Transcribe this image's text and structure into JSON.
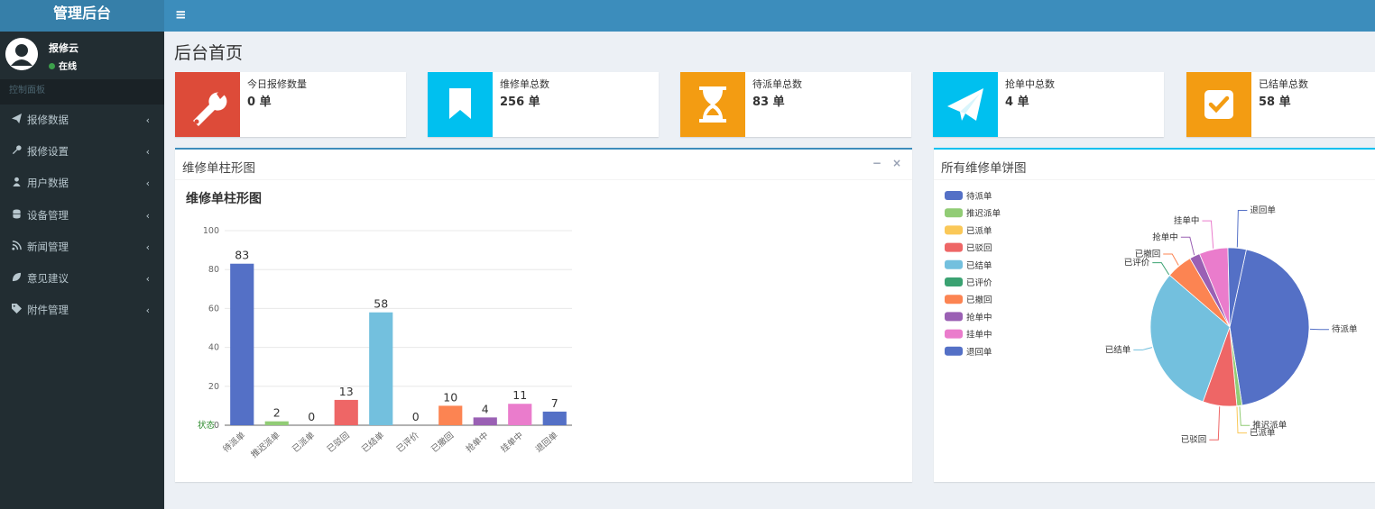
{
  "sidebar": {
    "logo": "管理后台",
    "user_name": "报修云",
    "user_status": "在线",
    "section_header": "控制面板",
    "items": [
      {
        "label": "报修数据",
        "icon": "paper-plane-icon"
      },
      {
        "label": "报修设置",
        "icon": "wrench-icon"
      },
      {
        "label": "用户数据",
        "icon": "user-icon"
      },
      {
        "label": "设备管理",
        "icon": "database-icon"
      },
      {
        "label": "新闻管理",
        "icon": "rss-icon"
      },
      {
        "label": "意见建议",
        "icon": "leaf-icon"
      },
      {
        "label": "附件管理",
        "icon": "tags-icon"
      }
    ]
  },
  "header": {
    "menu_icon": "hamburger-icon"
  },
  "page": {
    "title": "后台首页"
  },
  "stats": [
    {
      "label": "今日报修数量",
      "value": "0 单",
      "icon": "wrench-icon",
      "color": "#dd4b39"
    },
    {
      "label": "维修单总数",
      "value": "256 单",
      "icon": "bookmark-icon",
      "color": "#00c0ef"
    },
    {
      "label": "待派单总数",
      "value": "83 单",
      "icon": "hourglass-icon",
      "color": "#f39c12"
    },
    {
      "label": "抢单中总数",
      "value": "4 单",
      "icon": "paper-plane-icon",
      "color": "#00c0ef"
    },
    {
      "label": "已结单总数",
      "value": "58 单",
      "icon": "check-square-icon",
      "color": "#f39c12"
    }
  ],
  "bar_box": {
    "title": "维修单柱形图",
    "minimize_icon": "minus-icon",
    "close_icon": "close-icon"
  },
  "pie_box": {
    "title": "所有维修单饼图"
  },
  "chart_data": [
    {
      "type": "bar",
      "title": "维修单柱形图",
      "xlabel": "状态",
      "ylabel": "",
      "ylim": [
        0,
        100
      ],
      "yticks": [
        0,
        20,
        40,
        60,
        80,
        100
      ],
      "categories": [
        "待派单",
        "推迟派单",
        "已派单",
        "已驳回",
        "已结单",
        "已评价",
        "已撤回",
        "抢单中",
        "挂单中",
        "退回单"
      ],
      "values": [
        83,
        2,
        0,
        13,
        58,
        0,
        10,
        4,
        11,
        7
      ],
      "colors": [
        "#5470c6",
        "#91cc75",
        "#fac858",
        "#ee6666",
        "#73c0de",
        "#3ba272",
        "#fc8452",
        "#9a60b4",
        "#ea7ccc",
        "#5470c6"
      ],
      "grid": true
    },
    {
      "type": "pie",
      "title": "",
      "legend_position": "left",
      "categories": [
        "待派单",
        "推迟派单",
        "已派单",
        "已驳回",
        "已结单",
        "已评价",
        "已撤回",
        "抢单中",
        "挂单中",
        "退回单"
      ],
      "values": [
        83,
        2,
        0,
        13,
        58,
        0,
        10,
        4,
        11,
        7
      ],
      "colors": [
        "#5470c6",
        "#91cc75",
        "#fac858",
        "#ee6666",
        "#73c0de",
        "#3ba272",
        "#fc8452",
        "#9a60b4",
        "#ea7ccc",
        "#5470c6"
      ]
    }
  ]
}
